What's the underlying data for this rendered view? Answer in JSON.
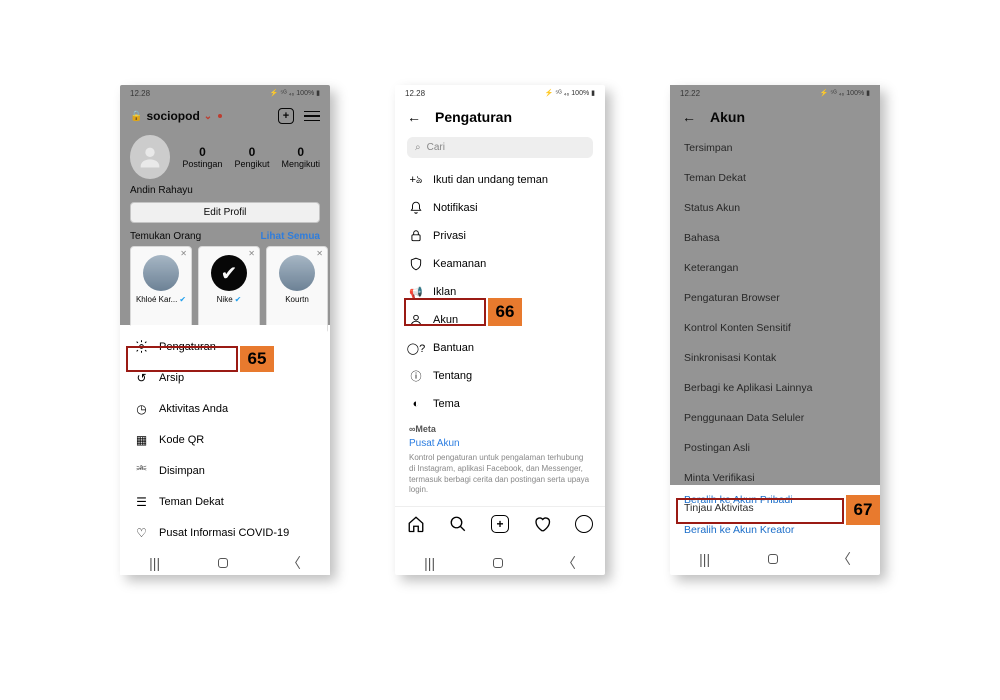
{
  "status": {
    "time1": "12.28",
    "time2": "12.28",
    "time3": "12.22",
    "right": "⚡ ⁵ᴳ ₄₆ 100% ▮",
    "icons": "⊠ ⅏ ⊑"
  },
  "p1": {
    "username": "sociopod",
    "stats": [
      {
        "n": "0",
        "l": "Postingan"
      },
      {
        "n": "0",
        "l": "Pengikut"
      },
      {
        "n": "0",
        "l": "Mengikuti"
      }
    ],
    "name": "Andin Rahayu",
    "edit": "Edit Profil",
    "discover": "Temukan Orang",
    "all": "Lihat Semua",
    "cards": [
      {
        "nm": "Khloé Kar..."
      },
      {
        "nm": "Nike"
      },
      {
        "nm": "Kourtn"
      }
    ],
    "menu": [
      "Pengaturan",
      "Arsip",
      "Aktivitas Anda",
      "Kode QR",
      "Disimpan",
      "Teman Dekat",
      "Pusat Informasi COVID-19"
    ]
  },
  "p2": {
    "title": "Pengaturan",
    "search": "Cari",
    "rows": [
      "Ikuti dan undang teman",
      "Notifikasi",
      "Privasi",
      "Keamanan",
      "Iklan",
      "Akun",
      "Bantuan",
      "Tentang",
      "Tema"
    ],
    "meta": "∞Meta",
    "metalink": "Pusat Akun",
    "metatxt": "Kontrol pengaturan untuk pengalaman terhubung di Instagram, aplikasi Facebook, dan Messenger, termasuk berbagi cerita dan postingan serta upaya login."
  },
  "p3": {
    "title": "Akun",
    "rows": [
      "Tersimpan",
      "Teman Dekat",
      "Status Akun",
      "Bahasa",
      "Keterangan",
      "Pengaturan Browser",
      "Kontrol Konten Sensitif",
      "Sinkronisasi Kontak",
      "Berbagi ke Aplikasi Lainnya",
      "Penggunaan Data Seluler",
      "Postingan Asli",
      "Minta Verifikasi",
      "Tinjau Aktivitas"
    ],
    "switch1": "Beralih ke Akun Pribadi",
    "switch2": "Beralih ke Akun Kreator"
  },
  "callouts": {
    "c65": "65",
    "c66": "66",
    "c67": "67"
  }
}
